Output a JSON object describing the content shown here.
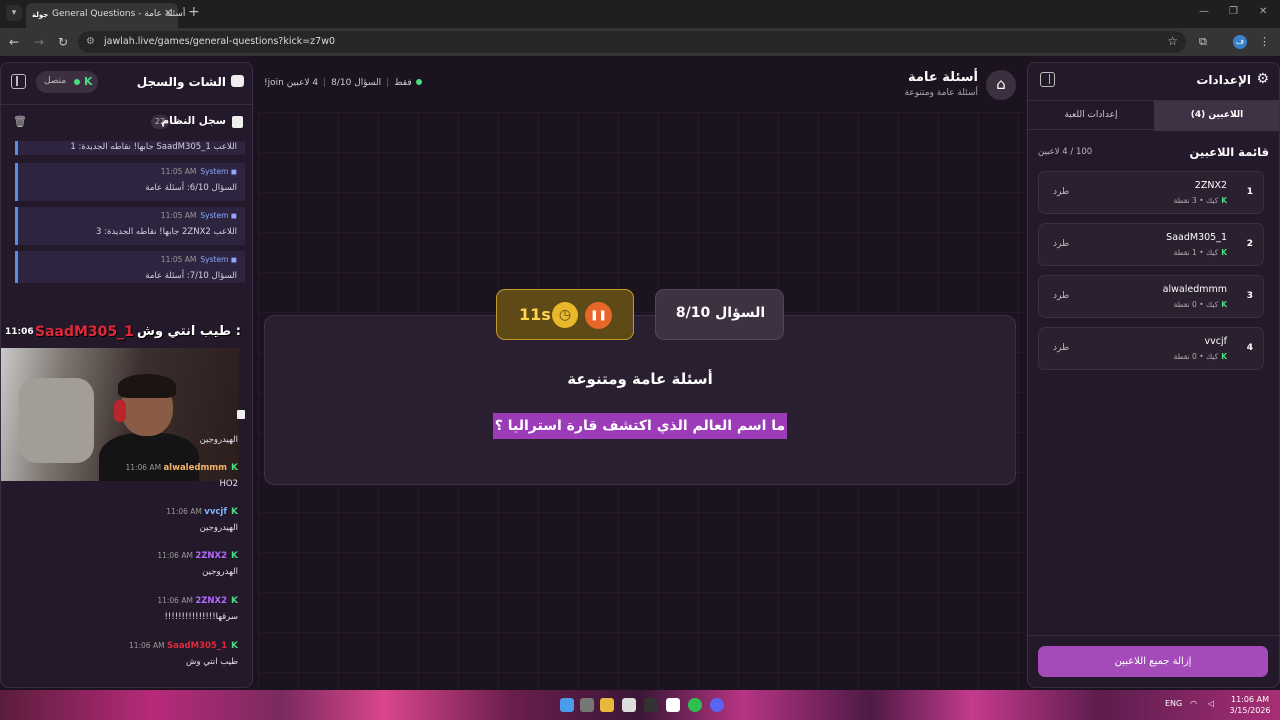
{
  "browser": {
    "tab_title": "General Questions - أسئلة عامة",
    "tab_favicon": "جولة",
    "url": "jawlah.live/games/general-questions?kick=z7w0"
  },
  "chat": {
    "title": "الشات والسجل",
    "status": "متصل",
    "status_platform": "K",
    "log_title": "سجل النظام",
    "log_count": "22",
    "log_items": [
      {
        "text": "اللاعب SaadM305_1 جابها! نقاطه الجديدة: 1"
      },
      {
        "sender": "System",
        "time": "11:05 AM",
        "text": "السؤال 6/10: أسئلة عامة"
      },
      {
        "sender": "System",
        "time": "11:05 AM",
        "text": "اللاعب 2ZNX2 جابها! نقاطه الجديدة: 3"
      },
      {
        "sender": "System",
        "time": "11:05 AM",
        "text": "السؤال 7/10: أسئلة عامة"
      }
    ],
    "overlay": {
      "time": "11:06",
      "user": "SaadM305_1",
      "message": "طيب انتي وش :"
    },
    "messages": [
      {
        "text": "الهيدروجين"
      },
      {
        "user": "alwaledmmm",
        "color": "#f2b56b",
        "time": "11:06 AM",
        "text": "HO2"
      },
      {
        "user": "vvcjf",
        "color": "#7bb6ff",
        "time": "11:06 AM",
        "text": "الهيدروجين"
      },
      {
        "user": "2ZNX2",
        "color": "#b36bff",
        "time": "11:06 AM",
        "text": "الهدروجين"
      },
      {
        "user": "2ZNX2",
        "color": "#b36bff",
        "time": "11:06 AM",
        "text": "سرقها!!!!!!!!!!!!!!!"
      },
      {
        "user": "SaadM305_1",
        "color": "#e0283a",
        "time": "11:06 AM",
        "text": "طيب انتي وش"
      }
    ]
  },
  "game": {
    "title": "أسئلة عامة",
    "subtitle": "أسئلة عامة ومتنوعة",
    "players_count": "4 لاعبين",
    "question_progress": "السؤال 8/10",
    "join_hint": "!join فقط",
    "timer": "11s",
    "question_label": "السؤال 8/10",
    "category": "أسئلة عامة ومتنوعة",
    "question": "ما اسم العالم الذي اكتشف قارة استراليا ؟"
  },
  "settings": {
    "title": "الإعدادات",
    "tab_players": "اللاعبين (4)",
    "tab_game": "إعدادات اللعبة",
    "list_title": "قائمة اللاعبين",
    "list_count": "100 / 4 لاعبين",
    "kick_label": "طرد",
    "platform_label": "كيك",
    "players": [
      {
        "rank": "1",
        "name": "2ZNX2",
        "points": "3 نقطة"
      },
      {
        "rank": "2",
        "name": "SaadM305_1",
        "points": "1 نقطة"
      },
      {
        "rank": "3",
        "name": "alwaledmmm",
        "points": "0 نقطة"
      },
      {
        "rank": "4",
        "name": "vvcjf",
        "points": "0 نقطة"
      }
    ],
    "remove_all": "إزالة جميع اللاعبين"
  },
  "taskbar": {
    "lang": "ENG",
    "time": "11:06 AM",
    "date": "3/15/2026"
  }
}
